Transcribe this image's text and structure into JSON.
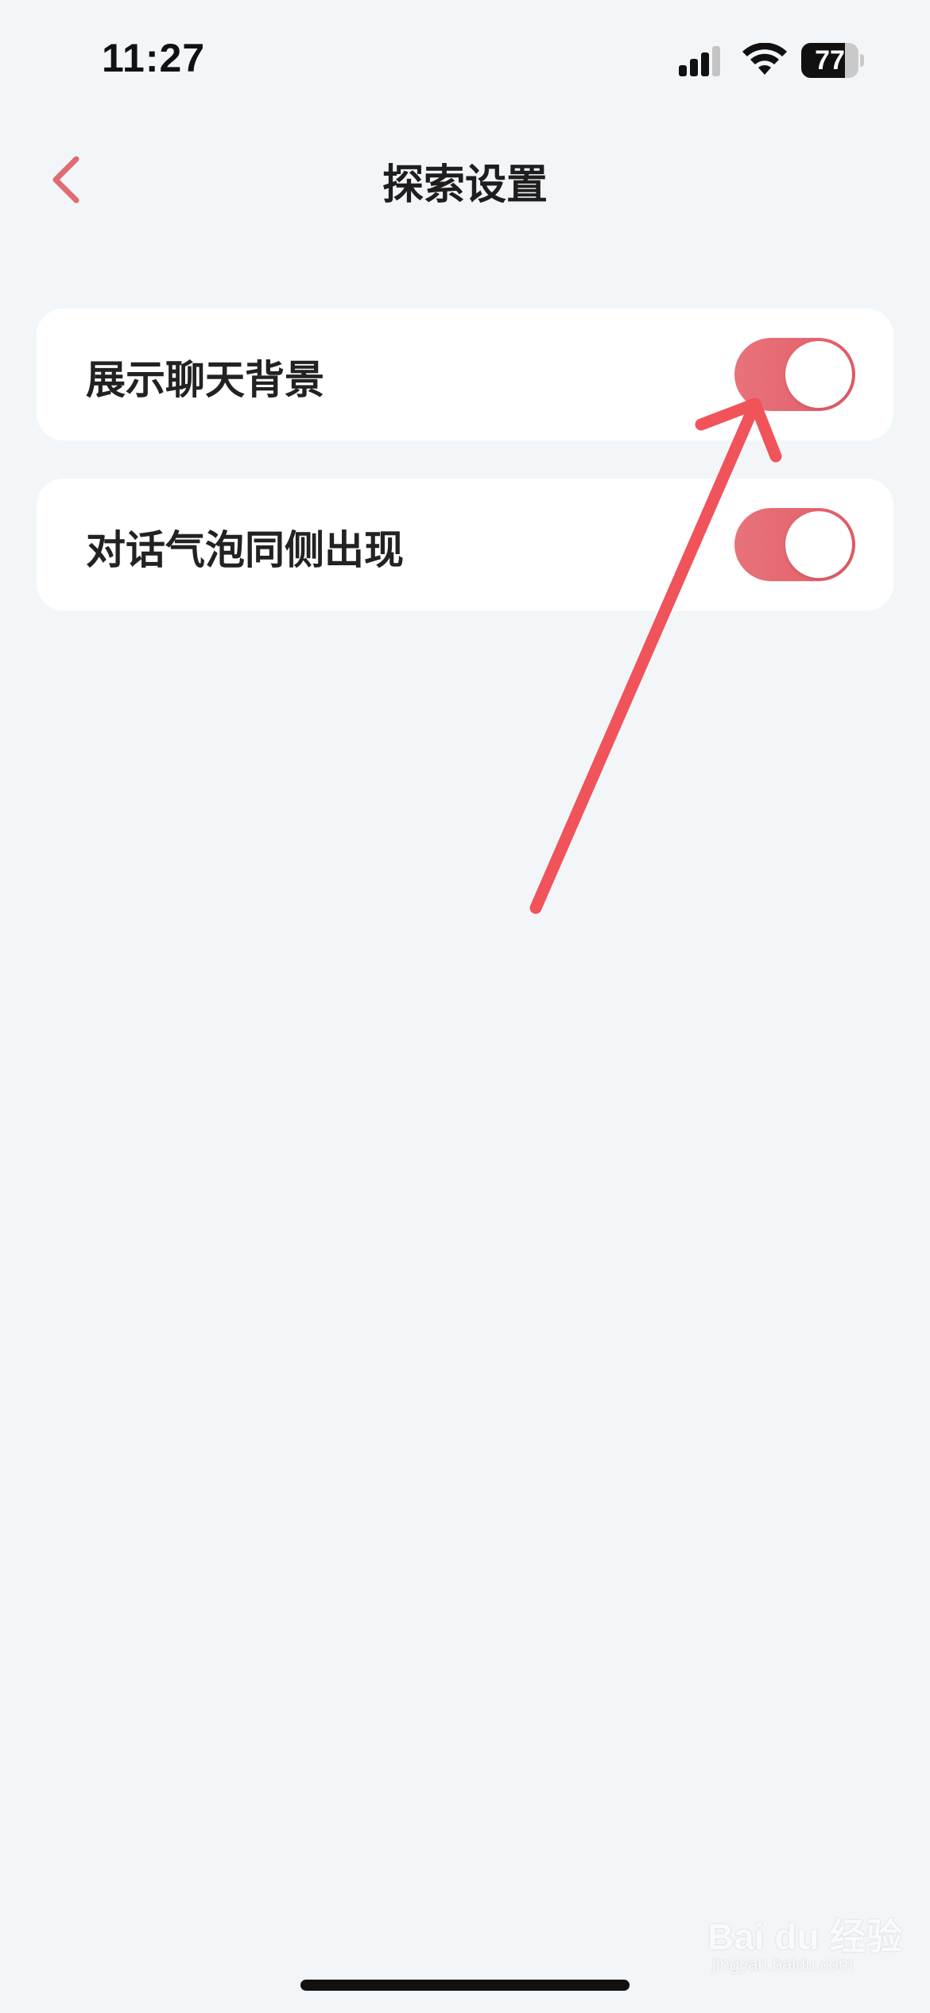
{
  "status_bar": {
    "time": "11:27",
    "battery_level": "77",
    "battery_percent": 77,
    "signal_icon": "cellular-signal-icon",
    "wifi_icon": "wifi-icon"
  },
  "nav": {
    "back_icon": "chevron-left-icon",
    "title": "探索设置"
  },
  "settings": [
    {
      "label": "展示聊天背景",
      "enabled": true
    },
    {
      "label": "对话气泡同侧出现",
      "enabled": true
    }
  ],
  "watermark": {
    "brand": "Bai du 经验",
    "sub": "jingyan.baidu.com"
  },
  "colors": {
    "accent": "#e4666f",
    "back_chevron": "#e06b72",
    "background": "#f3f6f9",
    "card": "#ffffff",
    "annotation_arrow": "#f0535a"
  }
}
